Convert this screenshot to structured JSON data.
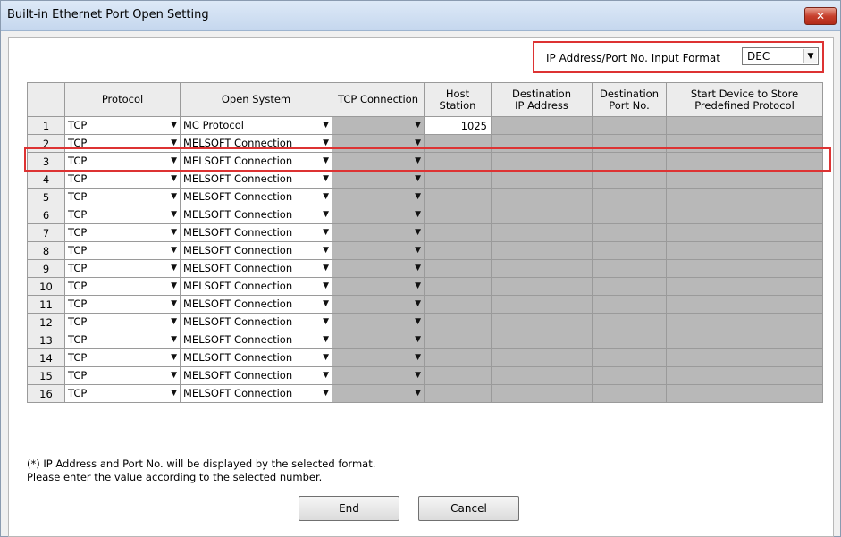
{
  "window": {
    "title": "Built-in Ethernet Port Open Setting",
    "close_label": "✕"
  },
  "format": {
    "label": "IP Address/Port No. Input Format",
    "value": "DEC"
  },
  "columns": {
    "rownum": "",
    "protocol": "Protocol",
    "open_system": "Open System",
    "tcp_connection": "TCP Connection",
    "host_station": "Host\nStation",
    "dest_ip": "Destination\nIP Address",
    "dest_port": "Destination\nPort No.",
    "start_device": "Start Device to Store\nPredefined Protocol"
  },
  "rows": [
    {
      "num": "1",
      "protocol": "TCP",
      "open_system": "MC Protocol",
      "tcp_connection": "",
      "host_station": "1025",
      "dest_ip": "",
      "dest_port": "",
      "start_device": ""
    },
    {
      "num": "2",
      "protocol": "TCP",
      "open_system": "MELSOFT Connection",
      "tcp_connection": "",
      "host_station": "",
      "dest_ip": "",
      "dest_port": "",
      "start_device": ""
    },
    {
      "num": "3",
      "protocol": "TCP",
      "open_system": "MELSOFT Connection",
      "tcp_connection": "",
      "host_station": "",
      "dest_ip": "",
      "dest_port": "",
      "start_device": ""
    },
    {
      "num": "4",
      "protocol": "TCP",
      "open_system": "MELSOFT Connection",
      "tcp_connection": "",
      "host_station": "",
      "dest_ip": "",
      "dest_port": "",
      "start_device": ""
    },
    {
      "num": "5",
      "protocol": "TCP",
      "open_system": "MELSOFT Connection",
      "tcp_connection": "",
      "host_station": "",
      "dest_ip": "",
      "dest_port": "",
      "start_device": ""
    },
    {
      "num": "6",
      "protocol": "TCP",
      "open_system": "MELSOFT Connection",
      "tcp_connection": "",
      "host_station": "",
      "dest_ip": "",
      "dest_port": "",
      "start_device": ""
    },
    {
      "num": "7",
      "protocol": "TCP",
      "open_system": "MELSOFT Connection",
      "tcp_connection": "",
      "host_station": "",
      "dest_ip": "",
      "dest_port": "",
      "start_device": ""
    },
    {
      "num": "8",
      "protocol": "TCP",
      "open_system": "MELSOFT Connection",
      "tcp_connection": "",
      "host_station": "",
      "dest_ip": "",
      "dest_port": "",
      "start_device": ""
    },
    {
      "num": "9",
      "protocol": "TCP",
      "open_system": "MELSOFT Connection",
      "tcp_connection": "",
      "host_station": "",
      "dest_ip": "",
      "dest_port": "",
      "start_device": ""
    },
    {
      "num": "10",
      "protocol": "TCP",
      "open_system": "MELSOFT Connection",
      "tcp_connection": "",
      "host_station": "",
      "dest_ip": "",
      "dest_port": "",
      "start_device": ""
    },
    {
      "num": "11",
      "protocol": "TCP",
      "open_system": "MELSOFT Connection",
      "tcp_connection": "",
      "host_station": "",
      "dest_ip": "",
      "dest_port": "",
      "start_device": ""
    },
    {
      "num": "12",
      "protocol": "TCP",
      "open_system": "MELSOFT Connection",
      "tcp_connection": "",
      "host_station": "",
      "dest_ip": "",
      "dest_port": "",
      "start_device": ""
    },
    {
      "num": "13",
      "protocol": "TCP",
      "open_system": "MELSOFT Connection",
      "tcp_connection": "",
      "host_station": "",
      "dest_ip": "",
      "dest_port": "",
      "start_device": ""
    },
    {
      "num": "14",
      "protocol": "TCP",
      "open_system": "MELSOFT Connection",
      "tcp_connection": "",
      "host_station": "",
      "dest_ip": "",
      "dest_port": "",
      "start_device": ""
    },
    {
      "num": "15",
      "protocol": "TCP",
      "open_system": "MELSOFT Connection",
      "tcp_connection": "",
      "host_station": "",
      "dest_ip": "",
      "dest_port": "",
      "start_device": ""
    },
    {
      "num": "16",
      "protocol": "TCP",
      "open_system": "MELSOFT Connection",
      "tcp_connection": "",
      "host_station": "",
      "dest_ip": "",
      "dest_port": "",
      "start_device": ""
    }
  ],
  "dropdown_arrow": "▼",
  "footnote": {
    "line1": "(*) IP Address and Port No. will be displayed by the selected format.",
    "line2": "Please enter the value according to the selected number."
  },
  "buttons": {
    "end": "End",
    "cancel": "Cancel"
  },
  "colors": {
    "highlight": "#dd3333",
    "disabled_cell": "#b8b8b8"
  }
}
